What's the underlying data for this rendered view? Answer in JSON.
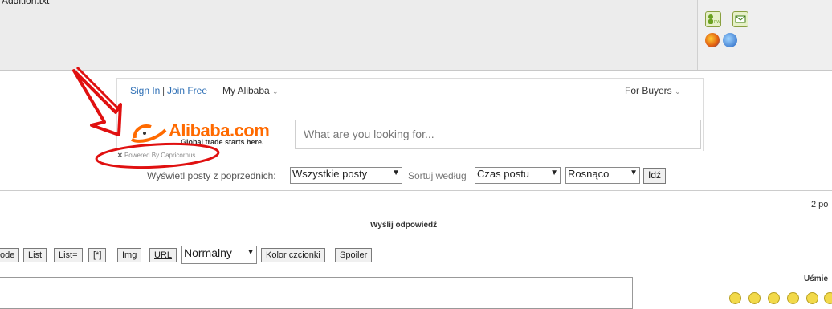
{
  "attachment": {
    "filename": "Addition.txt"
  },
  "right_panel": {
    "pm_badge": "PW"
  },
  "alibaba": {
    "sign_in": "Sign In",
    "separator": "|",
    "join_free": "Join Free",
    "my_alibaba": "My Alibaba",
    "for_buyers": "For Buyers",
    "logo_text": "Alibaba.com",
    "tagline": "Global trade starts here.",
    "search_placeholder": "What are you looking for...",
    "powered_by": "Powered By Capricornus",
    "close_x": "✕"
  },
  "filters": {
    "prefix_label": "Wyświetl posty z poprzednich:",
    "posts_value": "Wszystkie posty",
    "sort_label": "Sortuj według",
    "sort_value": "Czas postu",
    "order_value": "Rosnąco",
    "go_button": "Idź"
  },
  "page_count": "2 po",
  "reply_title": "Wyślij odpowiedź",
  "toolbar": {
    "code": "ode",
    "list": "List",
    "list_eq": "List=",
    "star": "[*]",
    "img": "Img",
    "url": "URL",
    "size_value": "Normalny",
    "font_color": "Kolor czcionki",
    "spoiler": "Spoiler"
  },
  "smilies_title": "Uśmie",
  "colors": {
    "accent": "#ff6a00",
    "link": "#2e6fb5",
    "arrow": "#e01010"
  }
}
